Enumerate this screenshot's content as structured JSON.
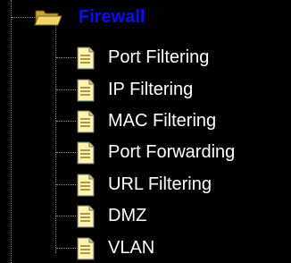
{
  "tree": {
    "folder": {
      "label": "Firewall",
      "icon": "folder-open-icon",
      "color": "#0b0bff"
    },
    "items": [
      {
        "label": "Port Filtering",
        "icon": "page-icon"
      },
      {
        "label": "IP Filtering",
        "icon": "page-icon"
      },
      {
        "label": "MAC Filtering",
        "icon": "page-icon"
      },
      {
        "label": "Port Forwarding",
        "icon": "page-icon"
      },
      {
        "label": "URL Filtering",
        "icon": "page-icon"
      },
      {
        "label": "DMZ",
        "icon": "page-icon"
      },
      {
        "label": "VLAN",
        "icon": "page-icon"
      }
    ],
    "colors": {
      "background": "#000000",
      "item_text": "#ffffff",
      "connector": "#8a8a8a"
    }
  }
}
